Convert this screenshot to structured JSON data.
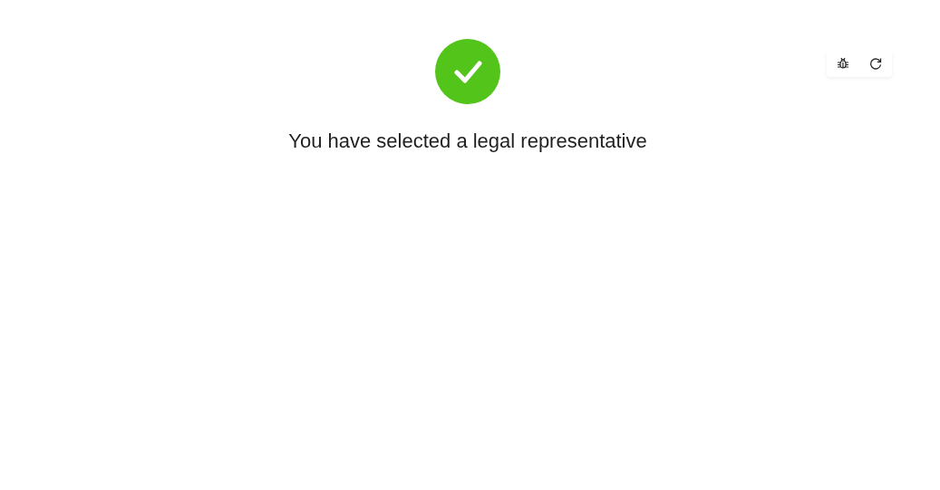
{
  "result": {
    "kind": "success",
    "title": "You have selected a legal representative"
  }
}
